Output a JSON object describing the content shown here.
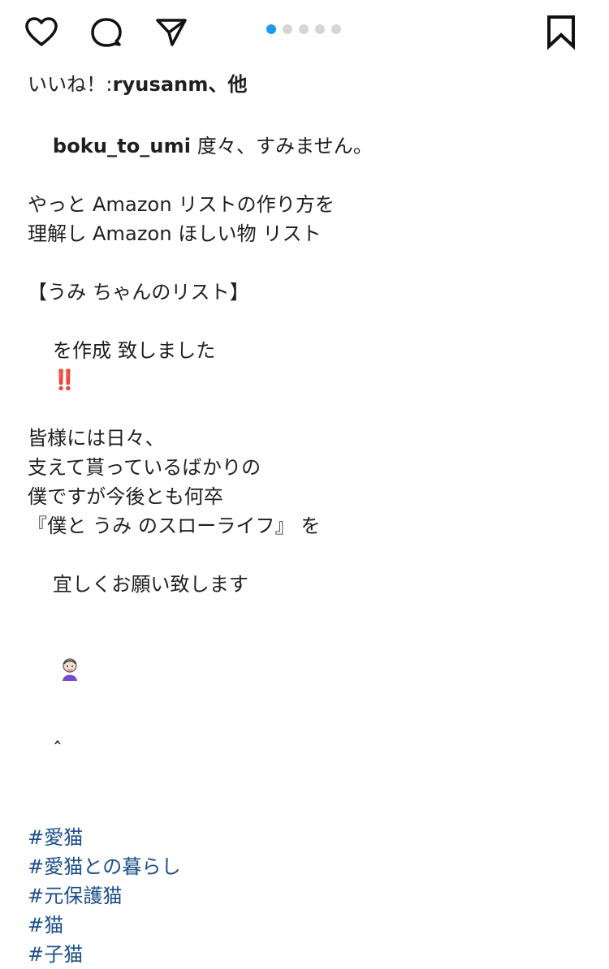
{
  "actions": {
    "like": "like",
    "comment": "comment",
    "share": "share",
    "save": "save"
  },
  "carousel": {
    "dots": [
      1,
      0,
      0,
      0,
      0
    ]
  },
  "likes": {
    "prefix": "いいね！: ",
    "user": "ryusanm",
    "suffix": "、他"
  },
  "caption": {
    "username": "boku_to_umi",
    "lines": [
      " 度々、すみません。",
      "やっと Amazon リストの作り方を",
      "理解し Amazon ほしい物 リスト",
      "",
      "【うみ ちゃんのリスト】",
      "を作成 致しました",
      "皆様には日々、",
      "支えて貰っているばかりの",
      "僕ですが今後とも何卒",
      "『僕と うみ のスローライフ』 を",
      "宜しくお願い致します"
    ]
  },
  "emoji": {
    "warning": "‼️",
    "person_suffix": "ˆ"
  },
  "hashtags": [
    "#愛猫",
    "#愛猫との暮らし",
    "#元保護猫",
    "#猫",
    "#子猫"
  ],
  "colors": {
    "text": "#1f1f1f",
    "hashtag": "#1b4f8a",
    "active_dot": "#1d9bf0",
    "inactive_dot": "#d6d6d6"
  }
}
